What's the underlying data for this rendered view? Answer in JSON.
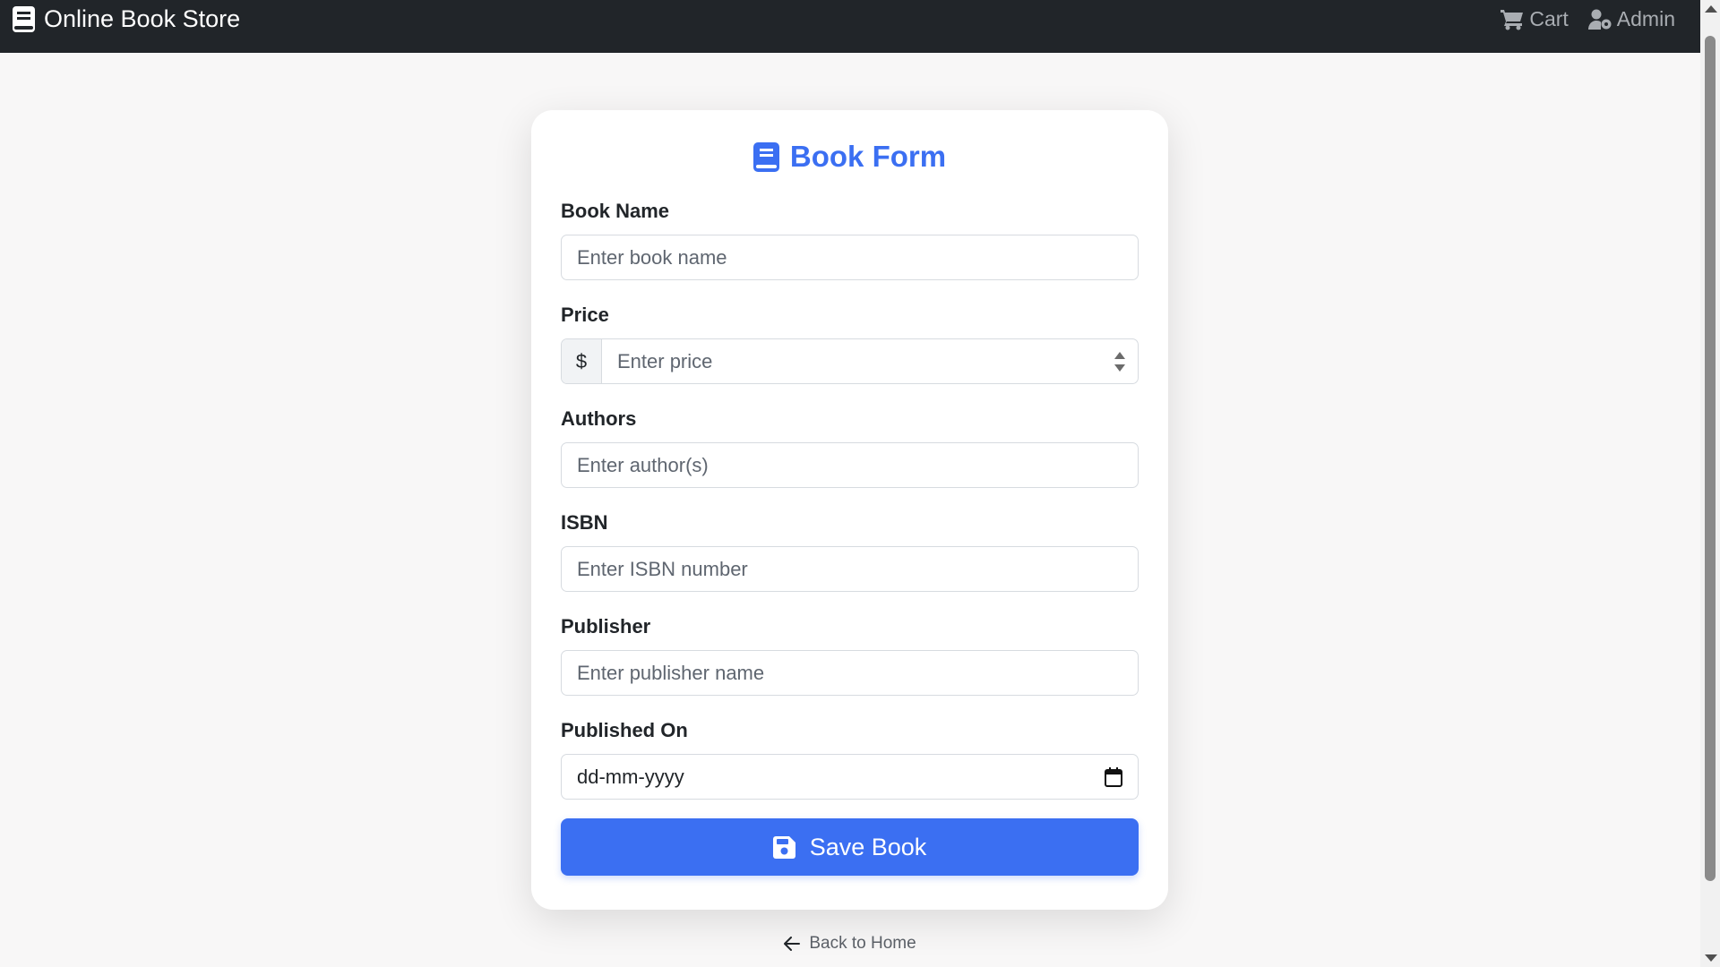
{
  "navbar": {
    "brand": "Online Book Store",
    "cart": "Cart",
    "admin": "Admin"
  },
  "form": {
    "title": "Book Form",
    "book_name": {
      "label": "Book Name",
      "placeholder": "Enter book name"
    },
    "price": {
      "label": "Price",
      "currency": "$",
      "placeholder": "Enter price"
    },
    "authors": {
      "label": "Authors",
      "placeholder": "Enter author(s)"
    },
    "isbn": {
      "label": "ISBN",
      "placeholder": "Enter ISBN number"
    },
    "publisher": {
      "label": "Publisher",
      "placeholder": "Enter publisher name"
    },
    "published_on": {
      "label": "Published On",
      "value": "dd-mm-yyyy"
    },
    "save_label": "Save Book"
  },
  "back_link": "Back to Home",
  "colors": {
    "primary": "#3b6ff2",
    "navbar": "#212529"
  },
  "icons": {
    "brand": "book-icon",
    "cart": "cart-icon",
    "admin": "user-gear-icon",
    "title": "book-icon",
    "calendar": "calendar-icon",
    "save": "floppy-disk-icon",
    "back": "arrow-left-icon"
  }
}
